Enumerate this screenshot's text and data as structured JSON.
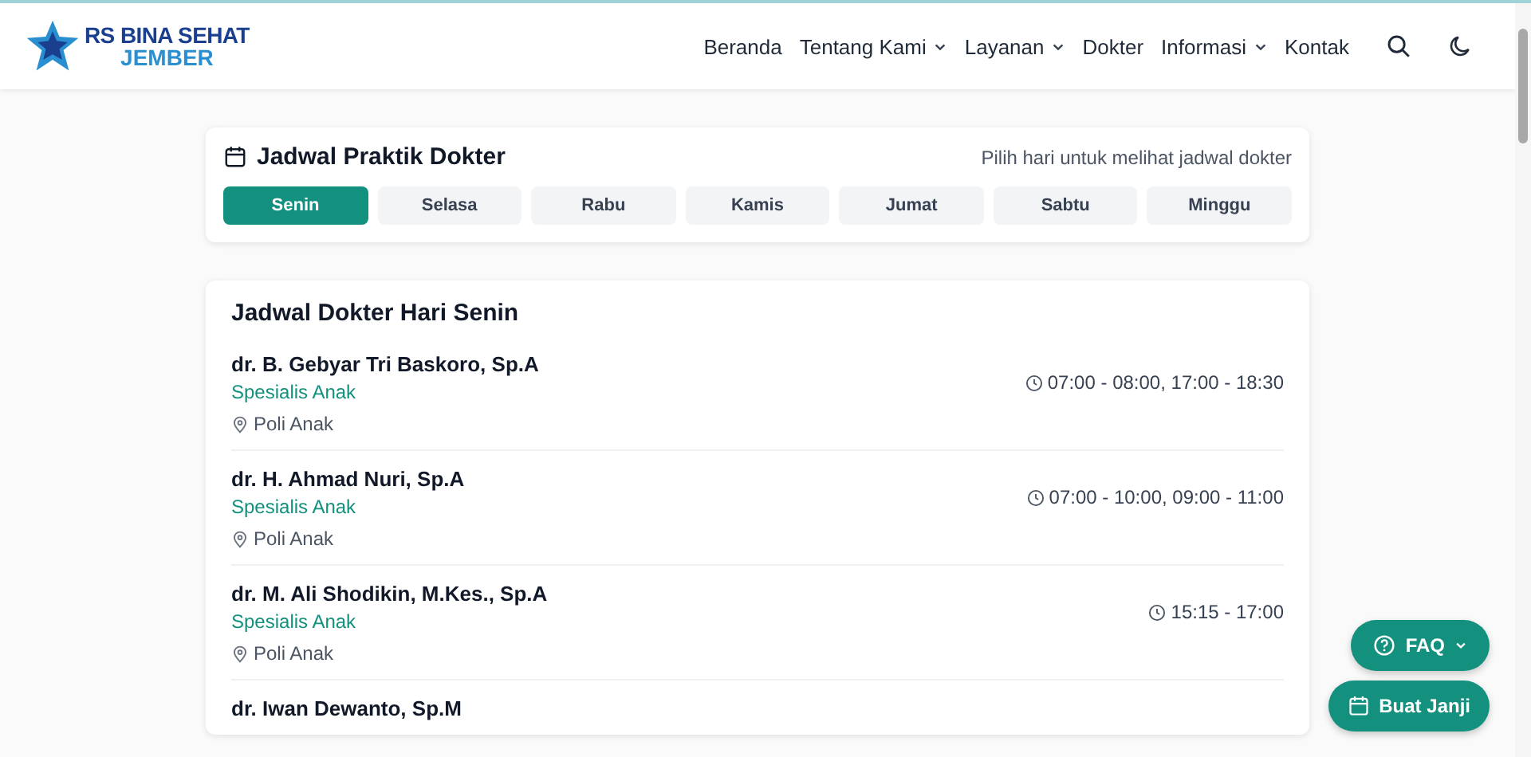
{
  "header": {
    "logo_line1": "RS BINA SEHAT",
    "logo_line2": "JEMBER",
    "nav": [
      {
        "label": "Beranda",
        "dropdown": false
      },
      {
        "label": "Tentang Kami",
        "dropdown": true
      },
      {
        "label": "Layanan",
        "dropdown": true
      },
      {
        "label": "Dokter",
        "dropdown": false
      },
      {
        "label": "Informasi",
        "dropdown": true
      },
      {
        "label": "Kontak",
        "dropdown": false
      }
    ]
  },
  "day_picker": {
    "title": "Jadwal Praktik Dokter",
    "hint": "Pilih hari untuk melihat jadwal dokter",
    "days": [
      {
        "label": "Senin",
        "selected": true
      },
      {
        "label": "Selasa",
        "selected": false
      },
      {
        "label": "Rabu",
        "selected": false
      },
      {
        "label": "Kamis",
        "selected": false
      },
      {
        "label": "Jumat",
        "selected": false
      },
      {
        "label": "Sabtu",
        "selected": false
      },
      {
        "label": "Minggu",
        "selected": false
      }
    ]
  },
  "schedule": {
    "title": "Jadwal Dokter Hari Senin",
    "doctors": [
      {
        "name": "dr. B. Gebyar Tri Baskoro, Sp.A",
        "specialty": "Spesialis Anak",
        "clinic": "Poli Anak",
        "hours": "07:00 - 08:00, 17:00 - 18:30"
      },
      {
        "name": "dr. H. Ahmad Nuri, Sp.A",
        "specialty": "Spesialis Anak",
        "clinic": "Poli Anak",
        "hours": "07:00 - 10:00, 09:00 - 11:00"
      },
      {
        "name": "dr. M. Ali Shodikin, M.Kes., Sp.A",
        "specialty": "Spesialis Anak",
        "clinic": "Poli Anak",
        "hours": "15:15 - 17:00"
      },
      {
        "name": "dr. Iwan Dewanto, Sp.M"
      }
    ]
  },
  "floating": {
    "faq": "FAQ",
    "appointment": "Buat Janji"
  }
}
